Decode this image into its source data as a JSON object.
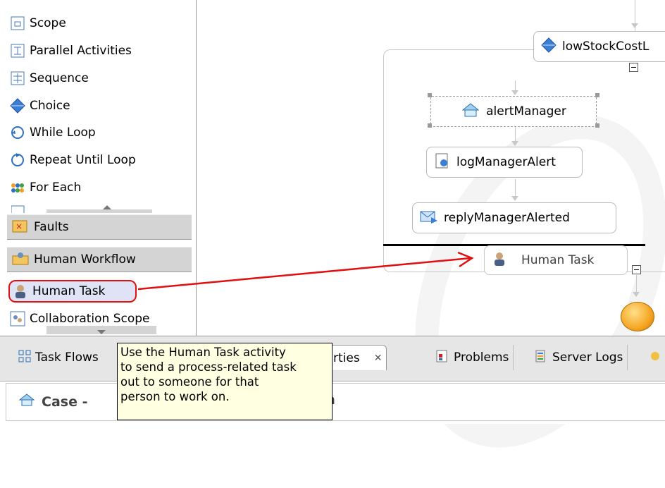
{
  "palette": {
    "items": [
      {
        "label": "Scope",
        "icon": "scope-icon"
      },
      {
        "label": "Parallel Activities",
        "icon": "parallel-activities-icon"
      },
      {
        "label": "Sequence",
        "icon": "sequence-icon"
      },
      {
        "label": "Choice",
        "icon": "choice-icon"
      },
      {
        "label": "While Loop",
        "icon": "while-loop-icon"
      },
      {
        "label": "Repeat Until Loop",
        "icon": "repeat-until-loop-icon"
      },
      {
        "label": "For Each",
        "icon": "for-each-icon"
      }
    ],
    "drawers": {
      "faults": {
        "label": "Faults",
        "icon": "faults-icon"
      },
      "human_workflow": {
        "label": "Human Workflow",
        "icon": "human-workflow-icon"
      }
    },
    "human_items": [
      {
        "label": "Human Task",
        "icon": "human-task-icon",
        "highlighted": true
      },
      {
        "label": "Collaboration Scope",
        "icon": "collaboration-scope-icon"
      }
    ]
  },
  "canvas": {
    "nodes": {
      "low_stock": "lowStockCostL",
      "alert_manager": "alertManager",
      "log_manager_alert": "logManagerAlert",
      "reply_manager_alerted": "replyManagerAlerted",
      "human_task": "Human Task"
    }
  },
  "tabs": [
    {
      "label": "Task Flows",
      "icon": "task-flows-icon"
    },
    {
      "label": "rties",
      "icon": "close-icon"
    },
    {
      "label": "Problems",
      "icon": "problems-icon"
    },
    {
      "label": "Server Logs",
      "icon": "server-logs-icon"
    }
  ],
  "properties": {
    "title": "Case - ",
    "title_tail": "a"
  },
  "tooltip": {
    "lines": [
      "Use the Human Task activity",
      "to send a process-related task",
      "out to someone for that",
      "person to work on."
    ]
  },
  "colors": {
    "highlight_red": "#e01010",
    "tooltip_bg": "#ffffe1",
    "drawer_bg": "#d4d4d4",
    "end_event": "#f5a623"
  }
}
